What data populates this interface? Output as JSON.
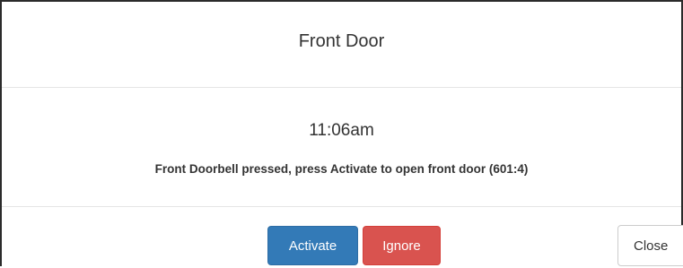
{
  "header": {
    "title": "Front Door"
  },
  "body": {
    "time": "11:06am",
    "message": "Front Doorbell pressed, press Activate to open front door (601:4)"
  },
  "footer": {
    "activate_label": "Activate",
    "ignore_label": "Ignore",
    "close_label": "Close"
  },
  "colors": {
    "activate": "#337ab7",
    "ignore": "#d9534f",
    "close": "#ffffff"
  }
}
